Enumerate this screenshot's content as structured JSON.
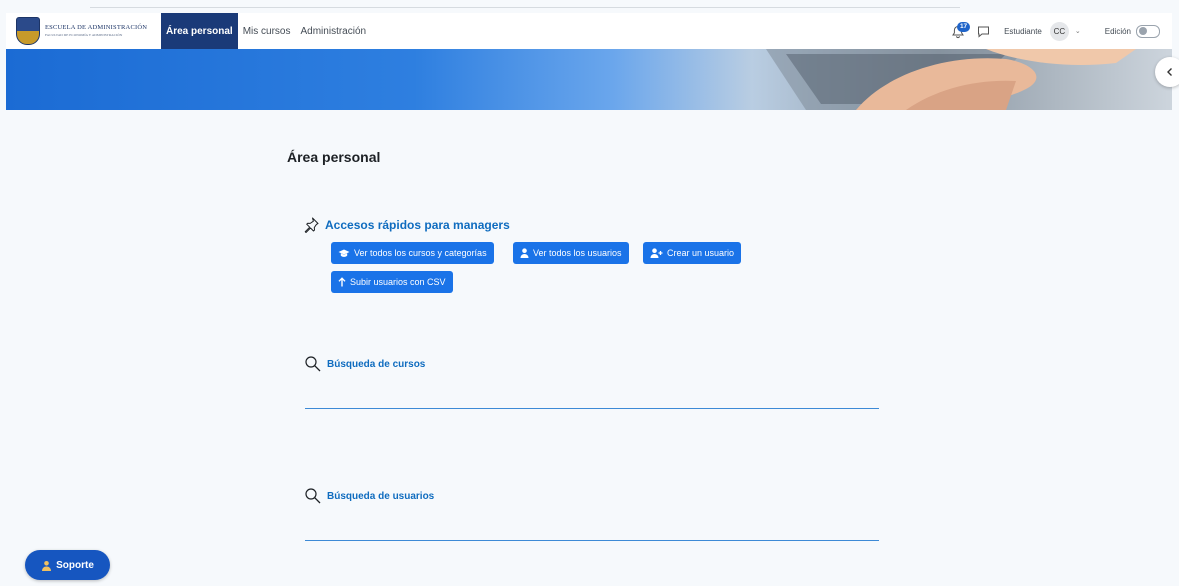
{
  "navbar": {
    "logo": {
      "title": "ESCUELA DE ADMINISTRACIÓN",
      "subtitle": "FACULTAD DE ECONOMÍA Y ADMINISTRACIÓN"
    },
    "links": [
      {
        "label": "Área personal",
        "active": true
      },
      {
        "label": "Mis cursos",
        "active": false
      },
      {
        "label": "Administración",
        "active": false
      }
    ],
    "notifications_count": "17",
    "role": "Estudiante",
    "avatar_initials": "CC",
    "edit_mode_label": "Edición",
    "edit_mode_on": false
  },
  "page": {
    "title": "Área personal"
  },
  "quick_access": {
    "title": "Accesos rápidos para managers",
    "buttons": [
      {
        "label": "Ver todos los cursos y categorías",
        "icon": "graduation-cap-icon"
      },
      {
        "label": "Ver todos los usuarios",
        "icon": "user-icon"
      },
      {
        "label": "Crear un usuario",
        "icon": "user-plus-icon"
      },
      {
        "label": "Subir usuarios con CSV",
        "icon": "arrow-up-icon"
      }
    ]
  },
  "course_search": {
    "title": "Búsqueda de cursos"
  },
  "user_search": {
    "title": "Búsqueda de usuarios"
  },
  "support": {
    "label": "Soporte"
  },
  "colors": {
    "primary": "#1a73e8",
    "nav_active": "#1a3a78",
    "link": "#0f6cbf",
    "support": "#1656c0"
  }
}
